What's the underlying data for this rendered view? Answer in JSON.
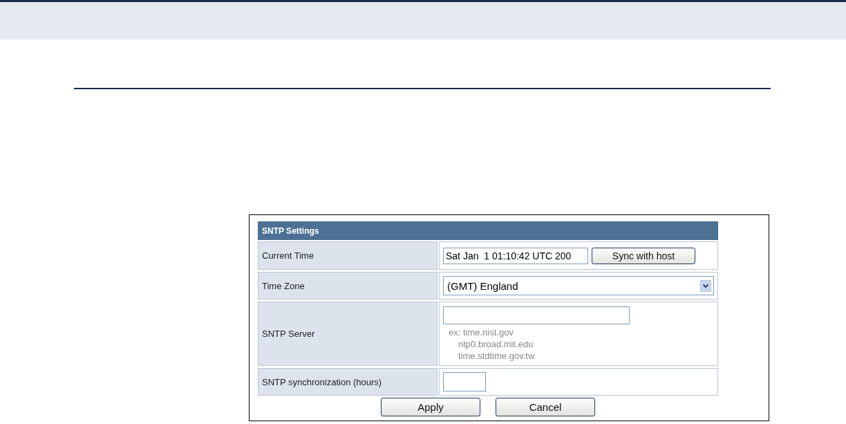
{
  "panel": {
    "title": "SNTP Settings",
    "rows": [
      {
        "kind": "time",
        "label": "Current Time",
        "value": "Sat Jan  1 01:10:42 UTC 200",
        "button": "Sync with host"
      },
      {
        "kind": "select",
        "label": "Time Zone",
        "value": "(GMT) England"
      },
      {
        "kind": "server",
        "label": "SNTP Server",
        "value": "",
        "hints": [
          "ex: time.nist.gov",
          "ntp0.broad.mit.edu",
          "time.stdtime.gov.tw"
        ]
      },
      {
        "kind": "small",
        "label": "SNTP synchronization (hours)",
        "value": ""
      }
    ],
    "buttons": [
      "Apply",
      "Cancel"
    ]
  }
}
